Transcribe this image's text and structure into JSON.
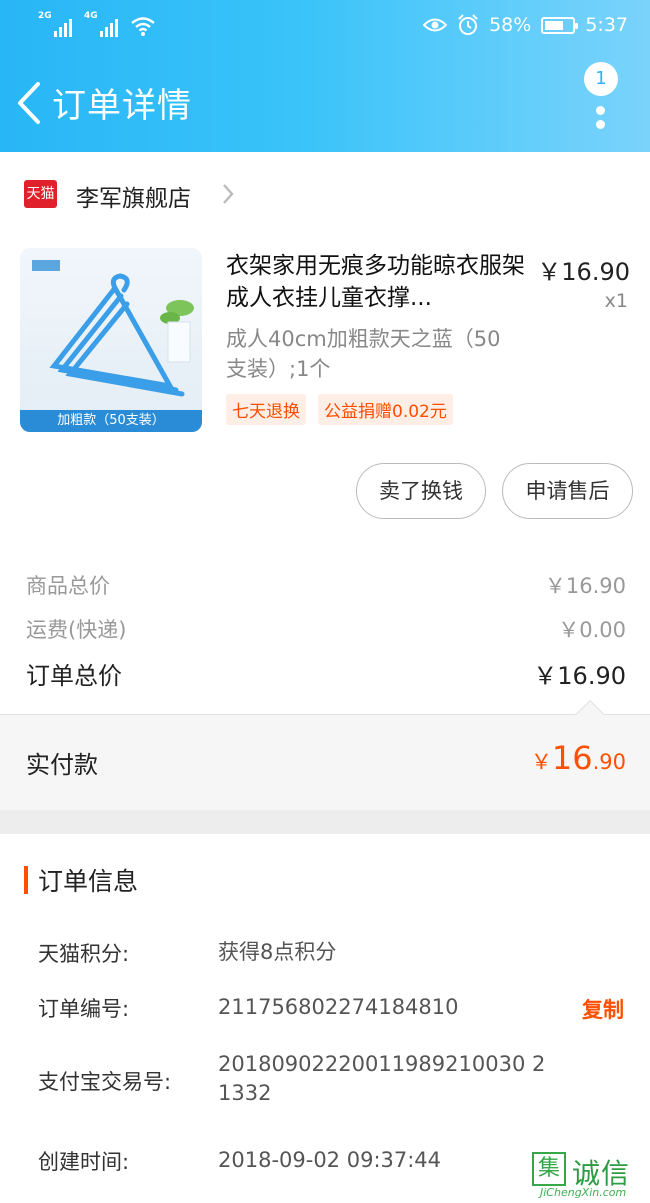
{
  "status_bar": {
    "net1": "2G",
    "net2": "4G",
    "battery_percent": "58%",
    "battery_level": 0.58,
    "time": "5:37"
  },
  "nav": {
    "title": "订单详情",
    "badge_count": "1"
  },
  "shop": {
    "logo_text": "天猫",
    "name": "李军旗舰店"
  },
  "product": {
    "title": "衣架家用无痕多功能晾衣服架成人衣挂儿童衣撑...",
    "price": "￥16.90",
    "quantity": "x1",
    "sku": "成人40cm加粗款天之蓝（50支装）;1个",
    "image_caption": "加粗款（50支装）",
    "tags": [
      "七天退换",
      "公益捐赠0.02元"
    ]
  },
  "actions": {
    "sell_label": "卖了换钱",
    "after_sale_label": "申请售后"
  },
  "totals": {
    "goods_label": "商品总价",
    "goods_value": "￥16.90",
    "shipping_label": "运费(快递)",
    "shipping_value": "￥0.00",
    "order_total_label": "订单总价",
    "order_total_value": "￥16.90"
  },
  "paid": {
    "label": "实付款",
    "currency": "￥",
    "integer": "16",
    "decimal": ".90"
  },
  "order_info": {
    "title": "订单信息",
    "rows": [
      {
        "label": "天猫积分:",
        "value": "获得8点积分"
      },
      {
        "label": "订单编号:",
        "value": "211756802274184810"
      },
      {
        "label": "支付宝交易号:",
        "value": "20180902220011989210030 21332"
      },
      {
        "label": "创建时间:",
        "value": "2018-09-02 09:37:44"
      }
    ],
    "copy_label": "复制"
  },
  "watermark": {
    "box_char": "集",
    "cn": "诚信",
    "en": "JiChengXin.com"
  },
  "colors": {
    "header": "#29b6f6",
    "accent": "#ff5000",
    "tmall_red": "#e0212b"
  }
}
